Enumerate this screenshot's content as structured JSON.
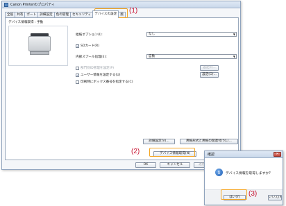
{
  "window": {
    "title": "Canon Printerのプロパティ",
    "tabs": [
      {
        "label": "全般"
      },
      {
        "label": "共有"
      },
      {
        "label": "ポート"
      },
      {
        "label": "詳細設定"
      },
      {
        "label": "色の管理"
      },
      {
        "label": "セキュリティ"
      },
      {
        "label": "デバイスの設定"
      },
      {
        "label": "版"
      }
    ],
    "status_label": "デバイス情報取得 : 手動",
    "options": {
      "optional_label": "給紙オプション(I):",
      "optional_value": "なし",
      "sd_card_label": "SDカード(R)",
      "spool_label": "内部スプール処理(E):",
      "spool_value": "自動",
      "dept_id_label": "部門別ID管理を設定(P)",
      "user_info_label": "ユーザー情報を設定する(U)",
      "auth_label": "印刷時にボックス番号を指定する(C)",
      "settings_button": "設定(I)...",
      "setup_button": "設定(O)..."
    },
    "buttons": {
      "detail_settings": "詳細設定(V)...",
      "format_select": "用紙形式と用紙の関連付け(L)...",
      "get_device_info": "デバイス情報取得(N)",
      "ok": "OK",
      "cancel": "キャンセル",
      "apply": "適用(A)"
    }
  },
  "dialog": {
    "title": "確認",
    "message": "デバイス情報を取得しますか?",
    "yes": "はい(Y)",
    "no": "いいえ(N)"
  },
  "callouts": {
    "one": "(1)",
    "two": "(2)",
    "three": "(3)"
  },
  "colors": {
    "highlight": "#f5a623",
    "callout": "#c8102e"
  }
}
